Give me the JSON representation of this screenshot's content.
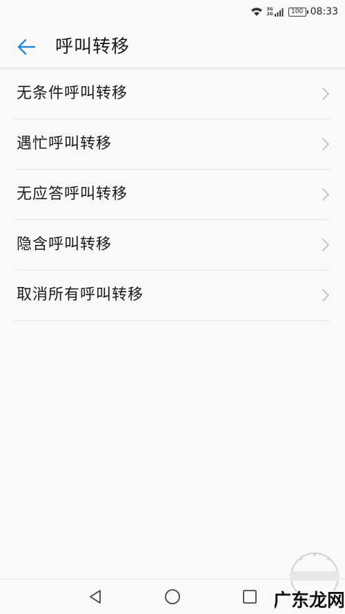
{
  "status_bar": {
    "network_top": "3G",
    "network_bottom": "2G",
    "battery": "100",
    "time": "08:33"
  },
  "header": {
    "title": "呼叫转移",
    "back_icon": "arrow-left-icon"
  },
  "menu": {
    "items": [
      {
        "label": "无条件呼叫转移"
      },
      {
        "label": "遇忙呼叫转移"
      },
      {
        "label": "无应答呼叫转移"
      },
      {
        "label": "隐含呼叫转移"
      },
      {
        "label": "取消所有呼叫转移"
      }
    ]
  },
  "nav_bar": {
    "back_icon": "triangle-back-icon",
    "home_icon": "circle-home-icon",
    "recent_icon": "square-recent-icon"
  },
  "watermark": {
    "text": "广东龙网"
  },
  "colors": {
    "accent": "#2a86d1",
    "background": "#f9f9fa",
    "divider": "#e0e0e0",
    "text": "#1a1a1a",
    "chevron": "#bdbdbd"
  }
}
